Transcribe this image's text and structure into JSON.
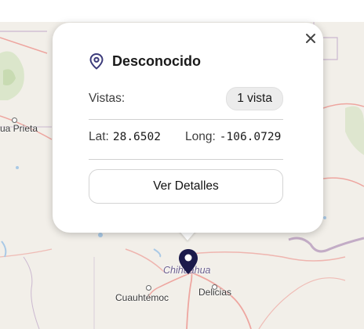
{
  "map": {
    "places": [
      {
        "name": "ua Prieta"
      },
      {
        "name": "Chihuahua"
      },
      {
        "name": "Cuauhtémoc"
      },
      {
        "name": "Delicias"
      }
    ],
    "colors": {
      "land": "#f2efe9",
      "state_border": "#b79bbd",
      "road": "#eea6a0",
      "water": "#a9c9e6",
      "green": "#d5e3c3",
      "marker": "#1b1a4b"
    }
  },
  "popup": {
    "icon": "location-pin-icon",
    "title": "Desconocido",
    "views_label": "Vistas:",
    "views_value": "1 vista",
    "lat_label": "Lat:",
    "lat_value": "28.6502",
    "lon_label": "Long:",
    "lon_value": "-106.0729",
    "details_button": "Ver Detalles",
    "close_icon": "close-icon"
  }
}
